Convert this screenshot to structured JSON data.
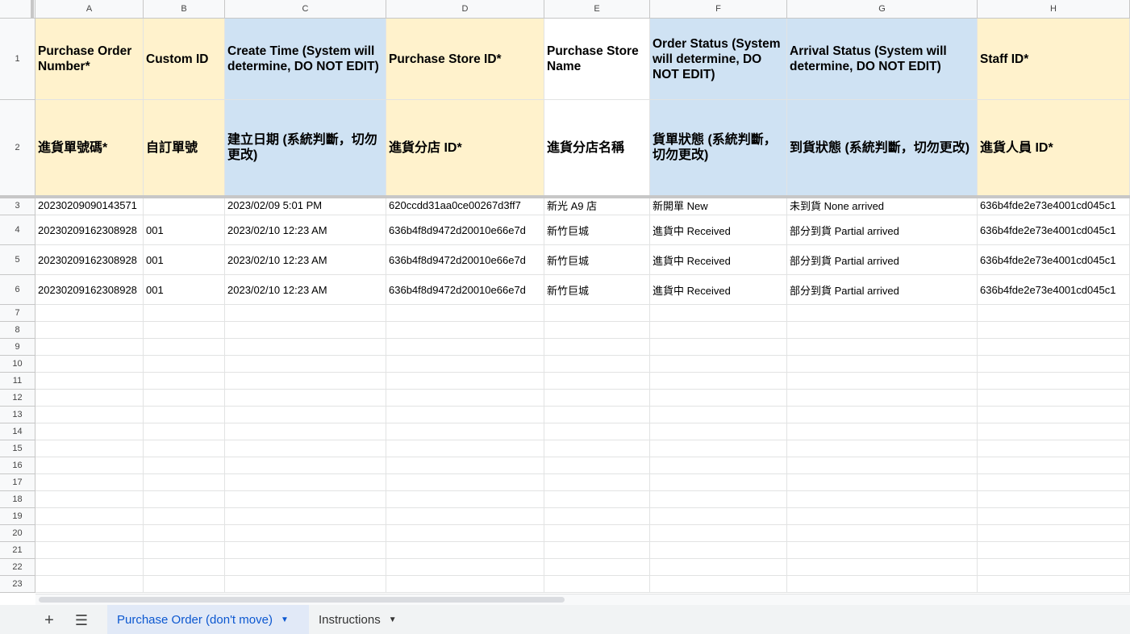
{
  "columns": [
    "A",
    "B",
    "C",
    "D",
    "E",
    "F",
    "G",
    "H"
  ],
  "row_numbers": [
    "1",
    "2",
    "3",
    "4",
    "5",
    "6",
    "7",
    "8",
    "9",
    "10",
    "11",
    "12",
    "13",
    "14",
    "15",
    "16",
    "17",
    "18",
    "19",
    "20",
    "21",
    "22",
    "23"
  ],
  "header_en": [
    "Purchase Order Number*",
    "Custom ID",
    "Create Time (System will determine, DO NOT EDIT)",
    "Purchase Store ID*",
    "Purchase Store Name",
    "Order Status (System will determine, DO NOT EDIT)",
    "Arrival Status (System will determine, DO NOT EDIT)",
    "Staff ID*"
  ],
  "header_zh": [
    "進貨單號碼*",
    "自訂單號",
    "建立日期 (系統判斷，切勿更改)",
    "進貨分店 ID*",
    "進貨分店名稱",
    "貨單狀態 (系統判斷，切勿更改)",
    "到貨狀態 (系統判斷，切勿更改)",
    "進貨人員 ID*"
  ],
  "header_colors": [
    "yellow",
    "yellow",
    "blue",
    "yellow",
    "white",
    "blue",
    "blue",
    "yellow"
  ],
  "rows": [
    [
      "20230209090143571",
      "",
      "2023/02/09 5:01 PM",
      "620ccdd31aa0ce00267d3ff7",
      "新光 A9 店",
      "新開單 New",
      "未到貨 None arrived",
      "636b4fde2e73e4001cd045c1"
    ],
    [
      "20230209162308928",
      "001",
      "2023/02/10 12:23 AM",
      "636b4f8d9472d20010e66e7d",
      "新竹巨城",
      "進貨中 Received",
      "部分到貨 Partial arrived",
      "636b4fde2e73e4001cd045c1"
    ],
    [
      "20230209162308928",
      "001",
      "2023/02/10 12:23 AM",
      "636b4f8d9472d20010e66e7d",
      "新竹巨城",
      "進貨中 Received",
      "部分到貨 Partial arrived",
      "636b4fde2e73e4001cd045c1"
    ],
    [
      "20230209162308928",
      "001",
      "2023/02/10 12:23 AM",
      "636b4f8d9472d20010e66e7d",
      "新竹巨城",
      "進貨中 Received",
      "部分到貨 Partial arrived",
      "636b4fde2e73e4001cd045c1"
    ]
  ],
  "tabs": [
    {
      "label": "Purchase Order (don't move)",
      "active": true
    },
    {
      "label": "Instructions",
      "active": false
    }
  ],
  "icons": {
    "add_sheet": "plus-icon",
    "all_sheets": "menu-icon",
    "tab_menu": "caret-down-icon"
  },
  "colors": {
    "yellow": "#fff2cc",
    "blue": "#cfe2f3",
    "active_tab_text": "#0b57d0",
    "active_tab_bg": "#e1e9f7"
  }
}
